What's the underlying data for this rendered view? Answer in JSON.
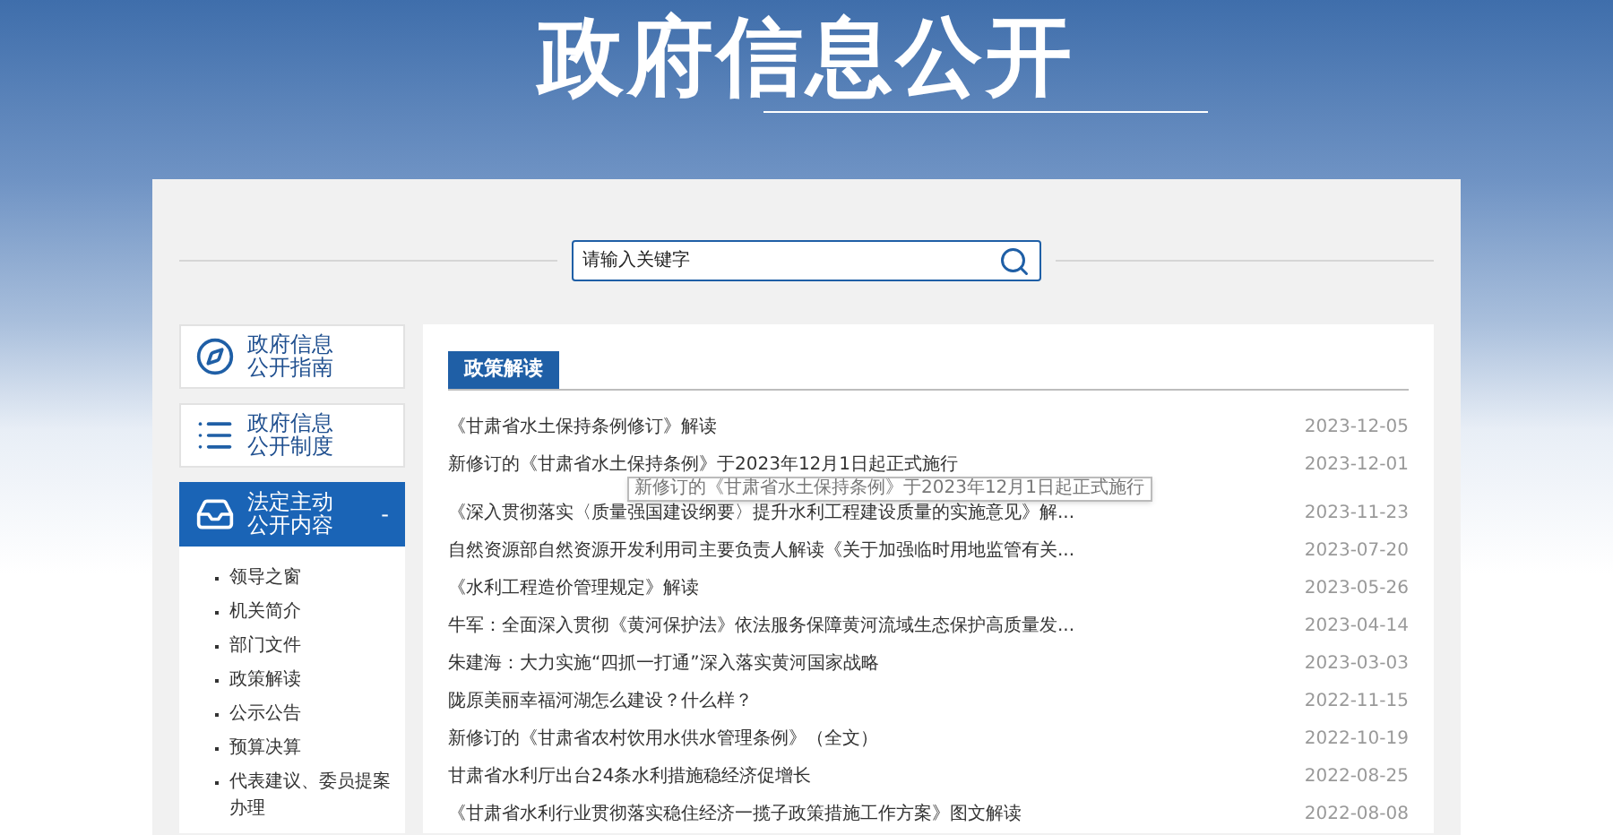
{
  "header": {
    "title": "政府信息公开"
  },
  "search": {
    "placeholder": "请输入关键字"
  },
  "sidebar": {
    "items": [
      {
        "label_line_1": "政府信息",
        "label_line_2": "公开指南",
        "selected": false
      },
      {
        "label_line_1": "政府信息",
        "label_line_2": "公开制度",
        "selected": false
      },
      {
        "label_line_1": "法定主动",
        "label_line_2": "公开内容",
        "selected": true,
        "expanded": true,
        "toggle": "-",
        "children": [
          "领导之窗",
          "机关简介",
          "部门文件",
          "政策解读",
          "公示公告",
          "预算决算",
          "代表建议、委员提案办理"
        ]
      }
    ]
  },
  "panel": {
    "tab": "政策解读",
    "rows": [
      {
        "title": "《甘肃省水土保持条例修订》解读",
        "date": "2023-12-05"
      },
      {
        "title": "新修订的《甘肃省水土保持条例》于2023年12月1日起正式施行",
        "date": "2023-12-01",
        "tooltip": "新修订的《甘肃省水土保持条例》于2023年12月1日起正式施行"
      },
      {
        "title": "《深入贯彻落实〈质量强国建设纲要〉提升水利工程建设质量的实施意见》解...",
        "date": "2023-11-23"
      },
      {
        "title": "自然资源部自然资源开发利用司主要负责人解读《关于加强临时用地监管有关...",
        "date": "2023-07-20"
      },
      {
        "title": "《水利工程造价管理规定》解读",
        "date": "2023-05-26"
      },
      {
        "title": "牛军：全面深入贯彻《黄河保护法》依法服务保障黄河流域生态保护高质量发...",
        "date": "2023-04-14"
      },
      {
        "title": "朱建海：大力实施“四抓一打通”深入落实黄河国家战略",
        "date": "2023-03-03"
      },
      {
        "title": "陇原美丽幸福河湖怎么建设？什么样？",
        "date": "2022-11-15"
      },
      {
        "title": "新修订的《甘肃省农村饮用水供水管理条例》（全文）",
        "date": "2022-10-19"
      },
      {
        "title": "甘肃省水利厅出台24条水利措施稳经济促增长",
        "date": "2022-08-25"
      },
      {
        "title": "《甘肃省水利行业贯彻落实稳住经济一揽子政策措施工作方案》图文解读",
        "date": "2022-08-08"
      }
    ]
  }
}
